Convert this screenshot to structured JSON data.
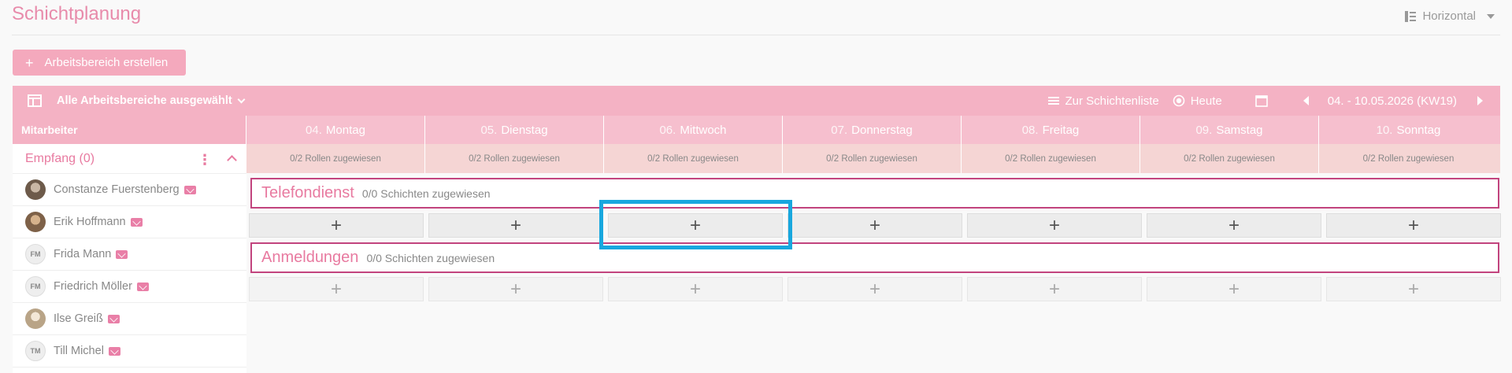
{
  "app": {
    "title": "Schichtplanung",
    "view_mode": "Horizontal",
    "create_button": "Arbeitsbereich erstellen"
  },
  "toolbar": {
    "area_selector": "Alle Arbeitsbereiche ausgewählt",
    "shift_list_link": "Zur Schichtenliste",
    "today_button": "Heute",
    "date_range": "04. - 10.05.2026 (KW19)"
  },
  "grid": {
    "employee_header": "Mitarbeiter",
    "days": [
      {
        "num": "04.",
        "name": "Montag"
      },
      {
        "num": "05.",
        "name": "Dienstag"
      },
      {
        "num": "06.",
        "name": "Mittwoch"
      },
      {
        "num": "07.",
        "name": "Donnerstag"
      },
      {
        "num": "08.",
        "name": "Freitag"
      },
      {
        "num": "09.",
        "name": "Samstag"
      },
      {
        "num": "10.",
        "name": "Sonntag"
      }
    ],
    "roles_text": "0/2 Rollen zugewiesen"
  },
  "group": {
    "name": "Empfang (0)",
    "employees": [
      {
        "name": "Constanze Fuerstenberg",
        "initials": ""
      },
      {
        "name": "Erik Hoffmann",
        "initials": ""
      },
      {
        "name": "Frida Mann",
        "initials": "FM"
      },
      {
        "name": "Friedrich Möller",
        "initials": "FM"
      },
      {
        "name": "Ilse Greiß",
        "initials": ""
      },
      {
        "name": "Till Michel",
        "initials": "TM"
      }
    ]
  },
  "areas": [
    {
      "name": "Telefondienst",
      "count": "0/0 Schichten zugewiesen"
    },
    {
      "name": "Anmeldungen",
      "count": "0/0 Schichten zugewiesen"
    }
  ],
  "colors": {
    "accent_pink": "#f4b2c4",
    "title_pink": "#e88bab",
    "area_border": "#c2447e",
    "highlight_blue": "#18a7de"
  },
  "icons": {
    "plus": "+",
    "view": "list-view-icon",
    "calendar": "calendar-icon"
  }
}
